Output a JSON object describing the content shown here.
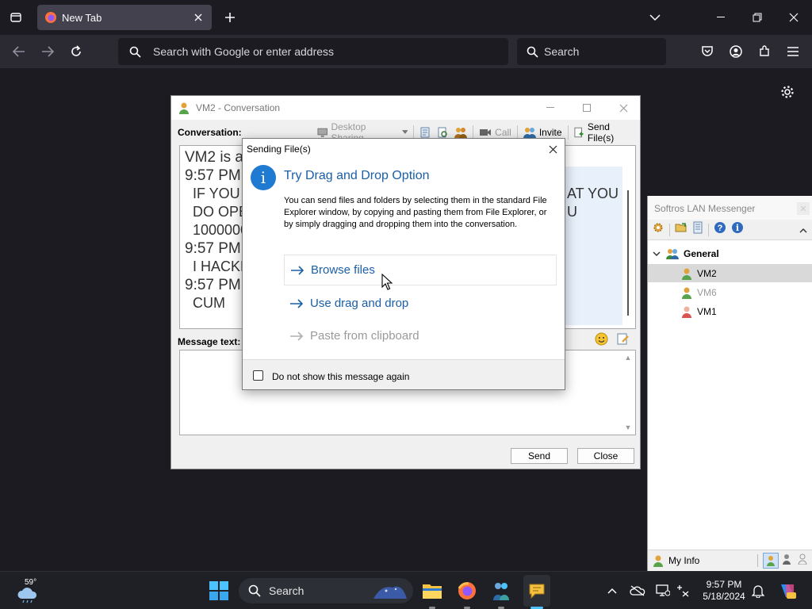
{
  "browser": {
    "tab_title": "New Tab",
    "urlbar_placeholder": "Search with Google or enter address",
    "search_placeholder": "Search"
  },
  "conversation": {
    "window_title": "VM2 - Conversation",
    "conversation_label": "Conversation:",
    "toolbar": {
      "desktop_sharing": "Desktop Sharing",
      "call": "Call",
      "invite": "Invite",
      "send_files": "Send File(s)"
    },
    "history": [
      {
        "text": "VM2 is av"
      },
      {
        "text": "9:57 PM"
      },
      {
        "text": "IF YOU"
      },
      {
        "text": "AT YOU"
      },
      {
        "text": "DO OPE"
      },
      {
        "text": "U"
      },
      {
        "text": "1000000"
      },
      {
        "text": "9:57 PM"
      },
      {
        "text": "I HACKE"
      },
      {
        "text": "9:57 PM"
      },
      {
        "text": "CUM"
      }
    ],
    "message_label": "Message text:",
    "send_label": "Send",
    "close_label": "Close"
  },
  "dialog": {
    "title": "Sending File(s)",
    "heading": "Try Drag and Drop Option",
    "body": "You can send files and folders by selecting them in the standard File Explorer window, by copying and pasting them from File Explorer, or by simply dragging and dropping them into the conversation.",
    "options": [
      {
        "label": "Browse files",
        "state": "hover"
      },
      {
        "label": "Use drag and drop",
        "state": "normal"
      },
      {
        "label": "Paste from clipboard",
        "state": "disabled"
      }
    ],
    "checkbox_label": "Do not show this message again",
    "checkbox_checked": false
  },
  "messenger": {
    "title": "Softros LAN Messenger",
    "group": "General",
    "users": [
      {
        "name": "VM2",
        "status": "selected"
      },
      {
        "name": "VM6",
        "status": "away"
      },
      {
        "name": "VM1",
        "status": "busy"
      }
    ],
    "my_info": "My Info"
  },
  "taskbar": {
    "temperature": "59°",
    "search_label": "Search",
    "time": "9:57 PM",
    "date": "5/18/2024",
    "apps": [
      "file-explorer",
      "firefox",
      "lan-messenger-app",
      "softros-chat"
    ]
  },
  "colors": {
    "accent_blue": "#1a5fa8",
    "firefox_dark": "#1c1b22",
    "info_icon": "#1f7ad1"
  }
}
